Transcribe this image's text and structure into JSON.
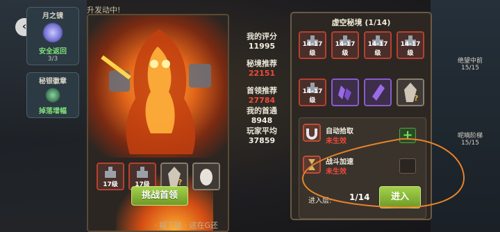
{
  "top_banner": "升发动中!",
  "left_cards": [
    {
      "title": "月之镜",
      "sub": "安全返回",
      "count": "3/3"
    },
    {
      "title": "秘银徽章",
      "sub": "掉落增幅",
      "count": ""
    }
  ],
  "boss": {
    "challenge_label": "挑战首领",
    "rewards": [
      {
        "level": "17级"
      },
      {
        "level": "17级"
      },
      {
        "level": ""
      },
      {
        "level": ""
      }
    ]
  },
  "stats": {
    "my_score_label": "我的评分",
    "my_score": "11995",
    "recommended_label": "秘境推荐",
    "recommended": "22151",
    "first_kill_rec_label": "首领推荐",
    "first_kill_rec": "27784",
    "my_first_label": "我的首通",
    "my_first": "8948",
    "player_avg_label": "玩家平均",
    "player_avg": "37859"
  },
  "void": {
    "title": "虚空秘境 (1/14)",
    "grid_levels": [
      "14-17级",
      "14-17级",
      "14-17级",
      "14-17级",
      "14-17级",
      "",
      "",
      ""
    ],
    "auto_pick_label": "自动拾取",
    "auto_pick_status": "未生效",
    "battle_speed_label": "战斗加速",
    "battle_speed_status": "未生效",
    "floor_label": "进入层:",
    "floor_value": "1/14",
    "enter_label": "进入"
  },
  "right_cards": [
    {
      "title": "绝望中前",
      "count": "15/15"
    },
    {
      "title": "呢喃阶梯",
      "count": "15/15"
    }
  ],
  "bottom_text": "· 福丁味 · 这在G还",
  "colors": {
    "accent_green": "#8bbb38",
    "warn_red": "#f04a3a",
    "annotation": "#e8832a"
  }
}
